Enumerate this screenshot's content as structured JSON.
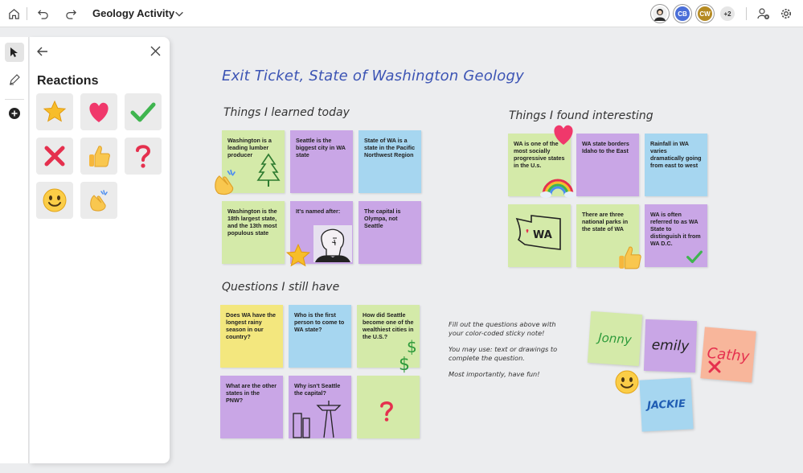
{
  "toolbar": {
    "home_icon": "home-icon",
    "undo_icon": "undo-icon",
    "redo_icon": "redo-icon",
    "title": "Geology Activity",
    "dropdown_icon": "chevron-down-icon",
    "avatars": [
      {
        "initials": "",
        "color": "#2b2b2b",
        "kind": "photo"
      },
      {
        "initials": "CB",
        "color": "#4b6fd8"
      },
      {
        "initials": "CW",
        "color": "#b58a22"
      }
    ],
    "overflow_count": "+2",
    "share_icon": "add-person-icon",
    "settings_icon": "settings-icon"
  },
  "tools": [
    {
      "name": "select-tool",
      "icon": "cursor-icon"
    },
    {
      "name": "pen-tool",
      "icon": "pen-icon"
    },
    {
      "name": "add-tool",
      "icon": "plus-circle-icon"
    }
  ],
  "reactions_panel": {
    "title": "Reactions",
    "back_icon": "back-arrow-icon",
    "close_icon": "close-icon",
    "reactions": [
      "star",
      "heart",
      "check",
      "cross",
      "thumbs-up",
      "question",
      "smile",
      "clap"
    ]
  },
  "canvas": {
    "title": "Exit Ticket, State of Washington Geology",
    "sections": {
      "learned": "Things I learned today",
      "interesting": "Things I found interesting",
      "questions": "Questions I still have"
    },
    "learned_notes": [
      {
        "text": "Washington is a leading lumber producer",
        "color": "green"
      },
      {
        "text": "Seattle is the biggest city in WA state",
        "color": "purple"
      },
      {
        "text": "State of WA is a state in the Pacific Northwest Region",
        "color": "blue"
      },
      {
        "text": "Washington is the 18th largest state, and the 13th most populous state",
        "color": "green"
      },
      {
        "text": "It's named after:",
        "color": "purple"
      },
      {
        "text": "The capital is Olympa, not Seattle",
        "color": "purple"
      }
    ],
    "interesting_notes": [
      {
        "text": "WA is one of the most socially progressive states in the U.s.",
        "color": "green"
      },
      {
        "text": "WA state borders Idaho to the East",
        "color": "purple"
      },
      {
        "text": "Rainfall in WA varies dramatically going from east to west",
        "color": "blue"
      },
      {
        "text": "",
        "color": "green",
        "drawing": "WA"
      },
      {
        "text": "There are three national parks in the state of WA",
        "color": "green"
      },
      {
        "text": "WA is often referred to as WA State to distinguish it from WA D.C.",
        "color": "purple"
      }
    ],
    "question_notes": [
      {
        "text": "Does WA have the longest rainy season in our country?",
        "color": "yellow"
      },
      {
        "text": "Who is the first person to come to WA state?",
        "color": "blue"
      },
      {
        "text": "How did Seattle become one of the wealthiest cities in the U.S.?",
        "color": "green"
      },
      {
        "text": "What are the other states in the PNW?",
        "color": "purple"
      },
      {
        "text": "Why isn't Seattle the capital?",
        "color": "purple"
      },
      {
        "text": "",
        "color": "green"
      }
    ],
    "instructions": [
      "Fill out the questions above with your color-coded sticky note!",
      "You may use: text or drawings to complete the question.",
      "Most importantly, have fun!"
    ],
    "names": [
      {
        "text": "Jonny",
        "color": "green"
      },
      {
        "text": "emily",
        "color": "purple"
      },
      {
        "text": "Cathy",
        "color": "orange"
      },
      {
        "text": "JACKIE",
        "color": "blue"
      }
    ]
  }
}
